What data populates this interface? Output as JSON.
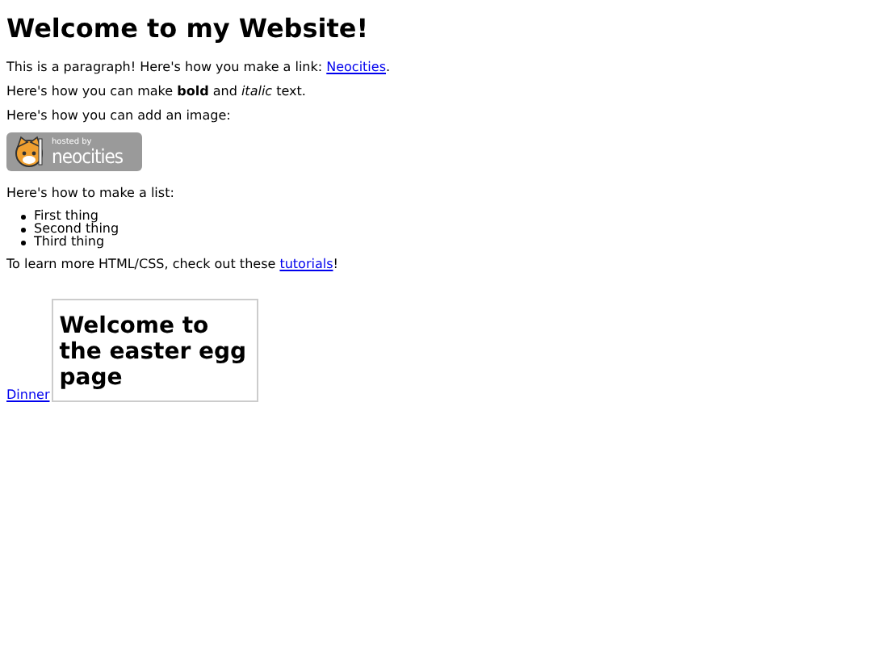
{
  "heading": "Welcome to my Website!",
  "intro": {
    "before": "This is a paragraph! Here's how you make a link: ",
    "link": "Neocities",
    "after": "."
  },
  "format_text": "Here's how you can make **bold** and *italic* text.",
  "image_text": "Here's how you can add an image:",
  "badge": {
    "top": "hosted by",
    "bottom": "neocities"
  },
  "list_text": "Here's how to make a list:",
  "list": [
    "First thing",
    "Second thing",
    "Third thing"
  ],
  "learn": {
    "before": "To learn more HTML/CSS, check out these ",
    "link": "tutorials",
    "after": "!"
  },
  "dinner_link": "Dinner",
  "frame": {
    "heading": "Welcome to the easter egg page"
  }
}
